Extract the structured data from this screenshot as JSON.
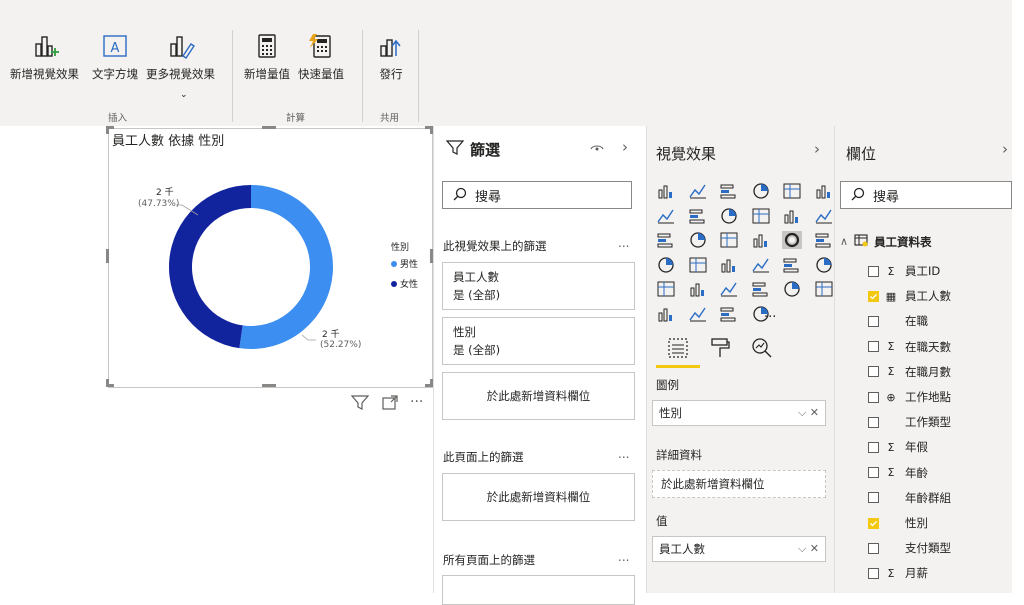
{
  "ribbon": {
    "buttons": [
      {
        "label": "新增視覺效果",
        "icon": "add-visual-icon"
      },
      {
        "label": "文字方塊",
        "icon": "text-box-icon"
      },
      {
        "label": "更多視覺效果",
        "icon": "more-visuals-icon"
      },
      {
        "label": "新增量值",
        "icon": "new-measure-icon"
      },
      {
        "label": "快速量值",
        "icon": "quick-measure-icon"
      },
      {
        "label": "發行",
        "icon": "publish-icon"
      }
    ],
    "groups": [
      "插入",
      "計算",
      "共用"
    ]
  },
  "visual": {
    "title": "員工人數 依據 性別",
    "legend_title": "性別",
    "legend_items": [
      "男性",
      "女性"
    ],
    "label_female_value": "2 千",
    "label_female_pct": "(47.73%)",
    "label_male_value": "2 千",
    "label_male_pct": "(52.27%)",
    "colors": {
      "male": "#3c8ef0",
      "female": "#12239e"
    }
  },
  "chart_data": {
    "type": "pie",
    "title": "員工人數 依據 性別",
    "categories": [
      "男性",
      "女性"
    ],
    "values": [
      52.27,
      47.73
    ],
    "unit": "%",
    "data_labels": [
      "2 千 (52.27%)",
      "2 千 (47.73%)"
    ],
    "legend": "right"
  },
  "filters": {
    "title": "篩選",
    "search_placeholder": "搜尋",
    "visual_section": "此視覺效果上的篩選",
    "cards": [
      {
        "field": "員工人數",
        "state": "是 (全部)"
      },
      {
        "field": "性別",
        "state": "是 (全部)"
      }
    ],
    "drop_here": "於此處新增資料欄位",
    "page_section": "此頁面上的篩選",
    "all_pages_section": "所有頁面上的篩選",
    "more": "..."
  },
  "viz": {
    "title": "視覺效果",
    "legend_label": "圖例",
    "legend_value": "性別",
    "details_label": "詳細資料",
    "details_placeholder": "於此處新增資料欄位",
    "values_label": "值",
    "values_value": "員工人數",
    "more": "..."
  },
  "fields": {
    "title": "欄位",
    "search_placeholder": "搜尋",
    "table_name": "員工資料表",
    "items": [
      {
        "name": "員工ID",
        "type": "Σ",
        "checked": false
      },
      {
        "name": "員工人數",
        "type": "▦",
        "checked": true
      },
      {
        "name": "在職",
        "type": "",
        "checked": false
      },
      {
        "name": "在職天數",
        "type": "Σ",
        "checked": false
      },
      {
        "name": "在職月數",
        "type": "Σ",
        "checked": false
      },
      {
        "name": "工作地點",
        "type": "⊕",
        "checked": false
      },
      {
        "name": "工作類型",
        "type": "",
        "checked": false
      },
      {
        "name": "年假",
        "type": "Σ",
        "checked": false
      },
      {
        "name": "年齡",
        "type": "Σ",
        "checked": false
      },
      {
        "name": "年齡群組",
        "type": "",
        "checked": false
      },
      {
        "name": "性別",
        "type": "",
        "checked": true
      },
      {
        "name": "支付類型",
        "type": "",
        "checked": false
      },
      {
        "name": "月薪",
        "type": "Σ",
        "checked": false
      }
    ]
  }
}
